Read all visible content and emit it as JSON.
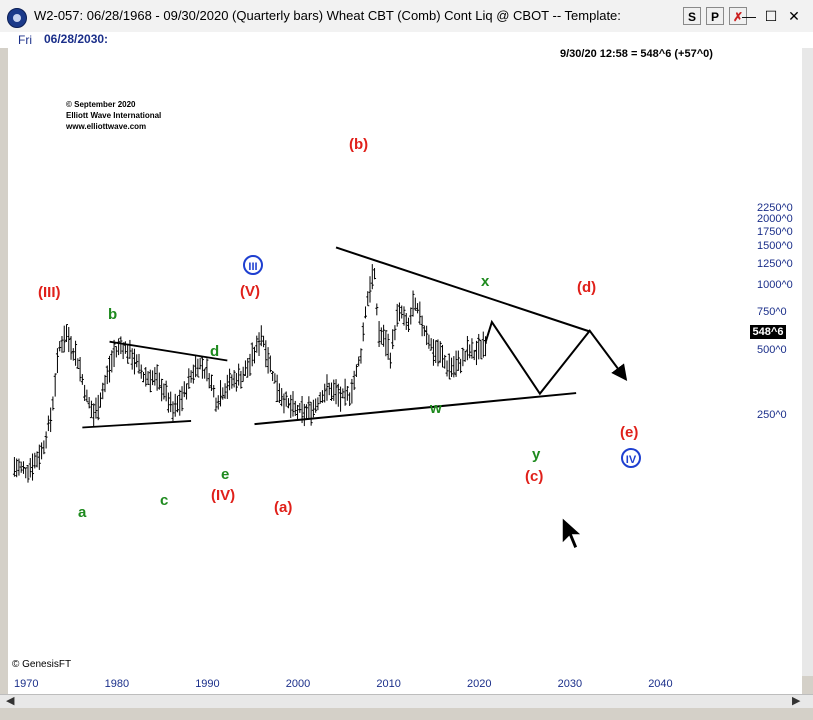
{
  "window": {
    "title": "W2-057:  06/28/1968 - 09/30/2020  (Quarterly bars)   Wheat CBT (Comb) Cont Liq @ CBOT  --  Template:",
    "buttons": [
      "S",
      "P",
      "✗"
    ],
    "controls": [
      "—",
      "☐",
      "✕"
    ]
  },
  "infobar": {
    "day": "Fri",
    "date": "06/28/2030:"
  },
  "quote": "9/30/20 12:58 = 548^6 (+57^0)",
  "copyright": [
    "© September 2020",
    "Elliott Wave International",
    "www.elliottwave.com"
  ],
  "footer_credit": "© GenesisFT",
  "scrollbar": {
    "left_arrow": "◀",
    "right_arrow": "▶"
  },
  "colors": {
    "red": "#e0201a",
    "green": "#1e8a1e",
    "blue": "#1e3fd0",
    "axis_text": "#1b2f8a"
  },
  "chart_data": {
    "type": "bar",
    "subtype": "ohlc-quarterly",
    "ylabel_unit": "cents/bushel (CBOT fractional ^ notation)",
    "yscale": "log",
    "ylim": [
      120,
      2600
    ],
    "xlim": [
      1968,
      2050
    ],
    "y_ticks": [
      {
        "value": 2250,
        "label": "2250^0"
      },
      {
        "value": 2000,
        "label": "2000^0"
      },
      {
        "value": 1750,
        "label": "1750^0"
      },
      {
        "value": 1500,
        "label": "1500^0"
      },
      {
        "value": 1250,
        "label": "1250^0"
      },
      {
        "value": 1000,
        "label": "1000^0"
      },
      {
        "value": 750,
        "label": "750^0"
      },
      {
        "value": 500,
        "label": "500^0"
      },
      {
        "value": 250,
        "label": "250^0"
      }
    ],
    "x_ticks": [
      {
        "value": 1970,
        "label": "1970"
      },
      {
        "value": 1980,
        "label": "1980"
      },
      {
        "value": 1990,
        "label": "1990"
      },
      {
        "value": 2000,
        "label": "2000"
      },
      {
        "value": 2010,
        "label": "2010"
      },
      {
        "value": 2020,
        "label": "2020"
      },
      {
        "value": 2030,
        "label": "2030"
      },
      {
        "value": 2040,
        "label": "2040"
      }
    ],
    "last_price": {
      "value": 548.75,
      "label": "548^6"
    },
    "price_anchors": [
      [
        1968.5,
        145
      ],
      [
        1970.0,
        140
      ],
      [
        1971.5,
        170
      ],
      [
        1972.5,
        240
      ],
      [
        1973.5,
        520
      ],
      [
        1974.2,
        600
      ],
      [
        1975.5,
        450
      ],
      [
        1976.5,
        300
      ],
      [
        1977.3,
        250
      ],
      [
        1978.5,
        350
      ],
      [
        1979.5,
        480
      ],
      [
        1980.3,
        530
      ],
      [
        1981.5,
        470
      ],
      [
        1982.8,
        380
      ],
      [
        1984.0,
        370
      ],
      [
        1985.0,
        330
      ],
      [
        1986.0,
        260
      ],
      [
        1987.0,
        300
      ],
      [
        1988.0,
        380
      ],
      [
        1988.8,
        440
      ],
      [
        1990.0,
        380
      ],
      [
        1990.8,
        290
      ],
      [
        1991.5,
        330
      ],
      [
        1992.5,
        360
      ],
      [
        1993.5,
        380
      ],
      [
        1994.5,
        430
      ],
      [
        1995.3,
        520
      ],
      [
        1995.8,
        600
      ],
      [
        1996.5,
        460
      ],
      [
        1997.5,
        340
      ],
      [
        1998.5,
        285
      ],
      [
        1999.5,
        265
      ],
      [
        2000.5,
        255
      ],
      [
        2001.5,
        270
      ],
      [
        2002.5,
        320
      ],
      [
        2003.5,
        330
      ],
      [
        2004.5,
        300
      ],
      [
        2005.5,
        310
      ],
      [
        2006.3,
        400
      ],
      [
        2006.8,
        500
      ],
      [
        2007.3,
        800
      ],
      [
        2007.8,
        1000
      ],
      [
        2008.2,
        1150
      ],
      [
        2008.7,
        600
      ],
      [
        2009.5,
        550
      ],
      [
        2010.0,
        470
      ],
      [
        2010.7,
        700
      ],
      [
        2011.3,
        750
      ],
      [
        2011.9,
        620
      ],
      [
        2012.5,
        800
      ],
      [
        2013.0,
        760
      ],
      [
        2013.5,
        660
      ],
      [
        2014.0,
        600
      ],
      [
        2014.7,
        500
      ],
      [
        2015.5,
        480
      ],
      [
        2016.3,
        420
      ],
      [
        2017.0,
        420
      ],
      [
        2017.8,
        440
      ],
      [
        2018.6,
        500
      ],
      [
        2019.4,
        480
      ],
      [
        2020.5,
        548
      ]
    ],
    "projection": [
      {
        "x": 2020.5,
        "y": 548
      },
      {
        "x": 2021.2,
        "y": 680
      },
      {
        "x": 2026.5,
        "y": 318
      },
      {
        "x": 2032.0,
        "y": 620
      },
      {
        "x": 2036.0,
        "y": 370
      }
    ],
    "trendlines": [
      {
        "name": "triangle-upper",
        "from": {
          "x": 2004.0,
          "y": 1500
        },
        "to": {
          "x": 2032.0,
          "y": 615
        }
      },
      {
        "name": "triangle-lower",
        "from": {
          "x": 1995.0,
          "y": 230
        },
        "to": {
          "x": 2030.5,
          "y": 320
        }
      },
      {
        "name": "inner-upper",
        "from": {
          "x": 1979.0,
          "y": 552
        },
        "to": {
          "x": 1992.0,
          "y": 452
        }
      },
      {
        "name": "inner-lower",
        "from": {
          "x": 1976.0,
          "y": 222
        },
        "to": {
          "x": 1988.0,
          "y": 238
        }
      }
    ],
    "labels": [
      {
        "text": "(III)",
        "color": "red"
      },
      {
        "text": "(IV)",
        "color": "red"
      },
      {
        "text": "(V)",
        "color": "red"
      },
      {
        "text": "(a)",
        "color": "red"
      },
      {
        "text": "(b)",
        "color": "red"
      },
      {
        "text": "(c)",
        "color": "red"
      },
      {
        "text": "(d)",
        "color": "red"
      },
      {
        "text": "(e)",
        "color": "red"
      },
      {
        "text": "a",
        "color": "green"
      },
      {
        "text": "b",
        "color": "green"
      },
      {
        "text": "c",
        "color": "green"
      },
      {
        "text": "d",
        "color": "green"
      },
      {
        "text": "e",
        "color": "green"
      },
      {
        "text": "w",
        "color": "green"
      },
      {
        "text": "x",
        "color": "green"
      },
      {
        "text": "y",
        "color": "green"
      },
      {
        "text": "III",
        "color": "blue",
        "style": "circled"
      },
      {
        "text": "IV",
        "color": "blue",
        "style": "circled"
      }
    ]
  }
}
